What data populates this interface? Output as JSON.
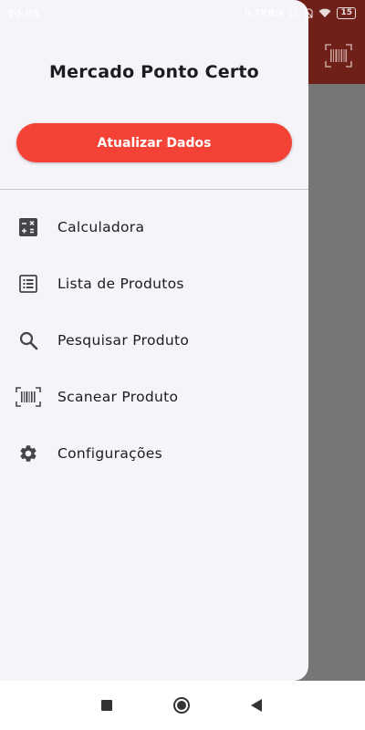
{
  "status_bar": {
    "time": "20:05",
    "net_speed": "0,7KB/s",
    "battery": "15"
  },
  "drawer": {
    "title": "Mercado Ponto Certo",
    "update_button": "Atualizar Dados",
    "items": [
      {
        "label": "Calculadora",
        "icon": "calculator-icon"
      },
      {
        "label": "Lista de Produtos",
        "icon": "list-icon"
      },
      {
        "label": "Pesquisar Produto",
        "icon": "search-icon"
      },
      {
        "label": "Scanear Produto",
        "icon": "barcode-scan-icon"
      },
      {
        "label": "Configurações",
        "icon": "gear-icon"
      }
    ]
  },
  "colors": {
    "app_bar": "#6e2019",
    "accent_button": "#f44336",
    "drawer_bg": "#f6f4f8",
    "scrim": "#767676"
  }
}
